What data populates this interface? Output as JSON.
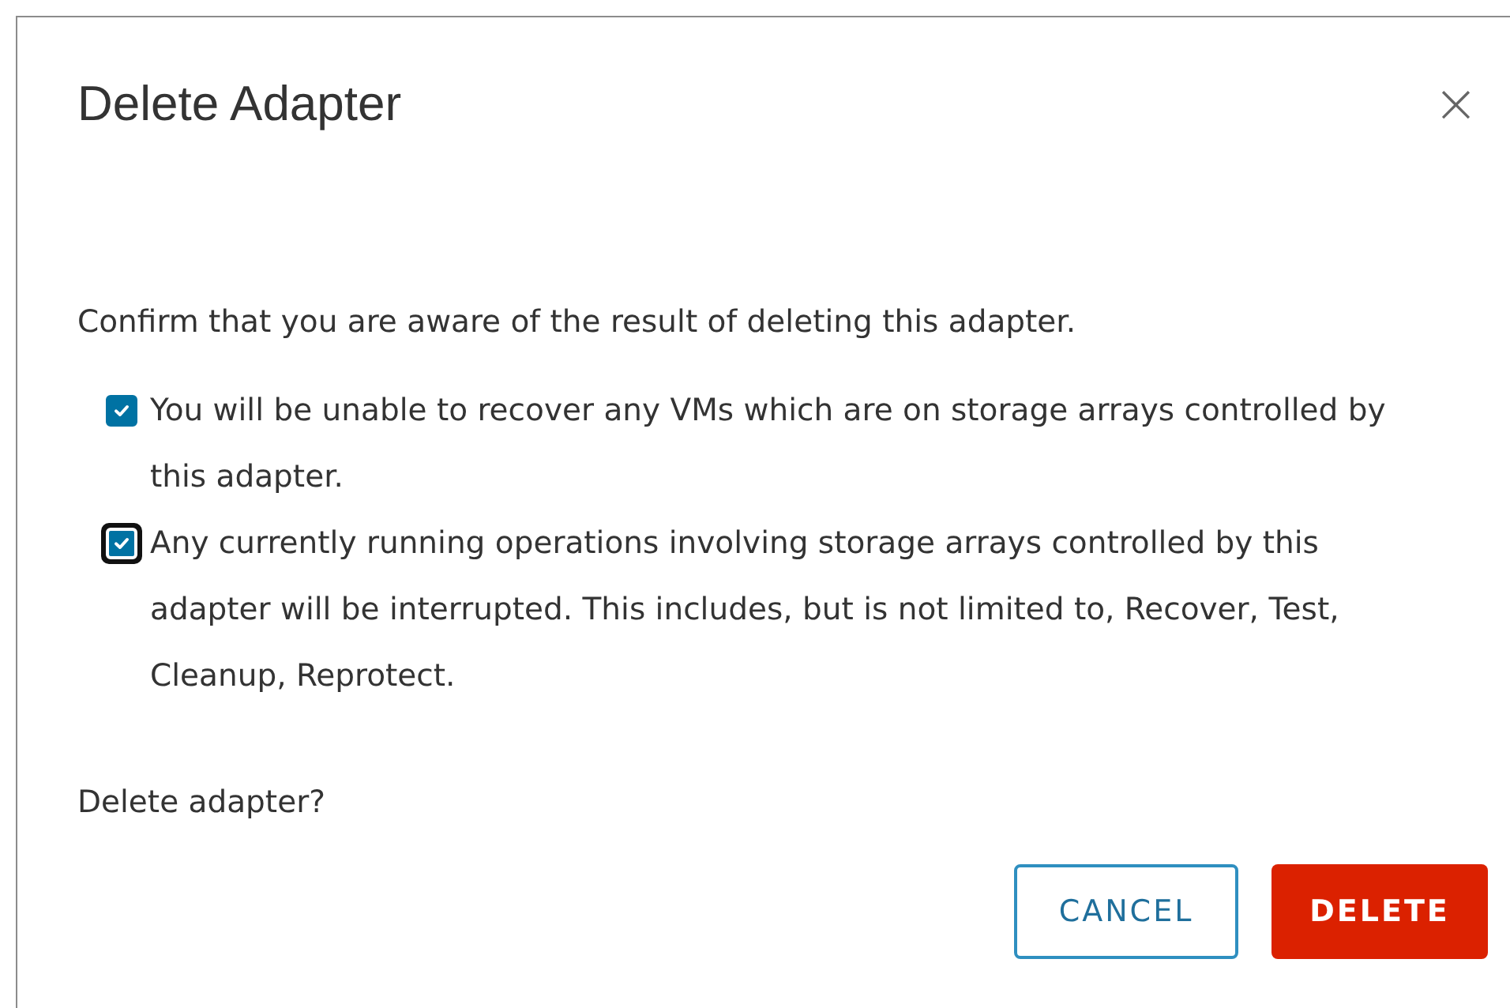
{
  "dialog": {
    "title": "Delete Adapter",
    "close": "×"
  },
  "intro": "Confirm that you are aware of the result of deleting this adapter.",
  "confirmations": [
    {
      "text": "You will be unable to recover any VMs which are on storage arrays controlled by this adapter.",
      "checked": true,
      "focused": false
    },
    {
      "text": "Any currently running operations involving storage arrays controlled by this adapter will be interrupted. This includes, but is not limited to, Recover, Test, Cleanup, Reprotect.",
      "checked": true,
      "focused": true
    }
  ],
  "question": "Delete adapter?",
  "buttons": [
    {
      "label": "CANCEL",
      "kind": "secondary"
    },
    {
      "label": "DELETE",
      "kind": "danger"
    }
  ]
}
